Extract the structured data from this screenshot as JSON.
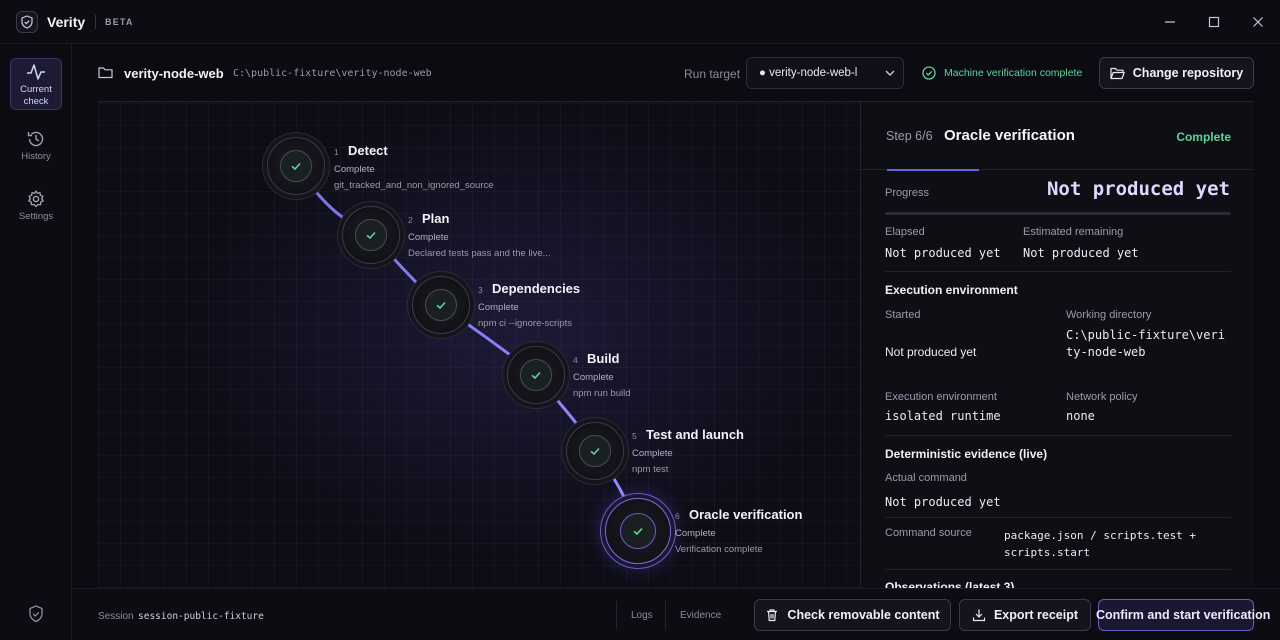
{
  "app": {
    "name": "Verity",
    "badge": "BETA"
  },
  "nav": {
    "items": [
      {
        "label": "Current check",
        "icon": "activity-icon"
      },
      {
        "label": "History",
        "icon": "history-icon"
      },
      {
        "label": "Settings",
        "icon": "gear-icon"
      }
    ]
  },
  "repo": {
    "name": "verity-node-web",
    "path": "C:\\public-fixture\\verity-node-web"
  },
  "run_target": {
    "label": "Run target",
    "value": "● verity-node-web-l"
  },
  "verification_status": "Machine verification complete",
  "change_repo_label": "Change repository",
  "steps": [
    {
      "num": "1",
      "title": "Detect",
      "status": "Complete",
      "detail": "git_tracked_and_non_ignored_source"
    },
    {
      "num": "2",
      "title": "Plan",
      "status": "Complete",
      "detail": "Declared tests pass and the live..."
    },
    {
      "num": "3",
      "title": "Dependencies",
      "status": "Complete",
      "detail": "npm ci --ignore-scripts"
    },
    {
      "num": "4",
      "title": "Build",
      "status": "Complete",
      "detail": "npm run build"
    },
    {
      "num": "5",
      "title": "Test and launch",
      "status": "Complete",
      "detail": "npm test"
    },
    {
      "num": "6",
      "title": "Oracle verification",
      "status": "Complete",
      "detail": "Verification complete"
    }
  ],
  "panel": {
    "step_count": "Step 6/6",
    "title": "Oracle verification",
    "status": "Complete",
    "progress_label": "Progress",
    "progress_value": "Not produced yet",
    "elapsed_label": "Elapsed",
    "elapsed_value": "Not produced yet",
    "remaining_label": "Estimated remaining",
    "remaining_value": "Not produced yet",
    "env_section": "Execution environment",
    "started_label": "Started",
    "started_value": "Not produced yet",
    "workdir_label": "Working directory",
    "workdir_value": "C:\\public-fixture\\verity-node-web",
    "exec_env_label": "Execution environment",
    "exec_env_value": "isolated runtime",
    "network_label": "Network policy",
    "network_value": "none",
    "evidence_section": "Deterministic evidence (live)",
    "actual_cmd_label": "Actual command",
    "actual_cmd_value": "Not produced yet",
    "cmd_source_label": "Command source",
    "cmd_source_value": "package.json / scripts.test + scripts.start",
    "observations_section": "Observations (latest 3)"
  },
  "bottom": {
    "session_label": "Session",
    "session_id": "session-public-fixture",
    "logs_tab": "Logs",
    "evidence_tab": "Evidence",
    "check_removable_label": "Check removable content",
    "export_receipt_label": "Export receipt",
    "confirm_label": "Confirm and start verification"
  },
  "colors": {
    "accent": "#7a6cd8",
    "success": "#5fd39a",
    "background": "#0b0b12"
  }
}
